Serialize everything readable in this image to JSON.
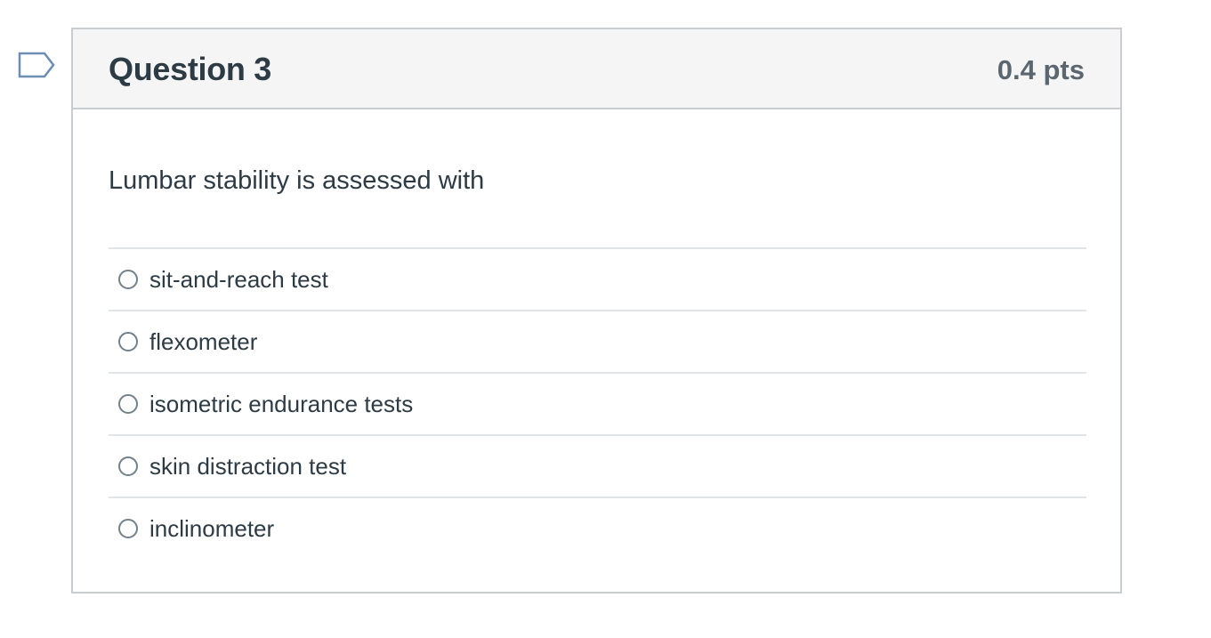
{
  "question": {
    "title": "Question 3",
    "points": "0.4 pts",
    "text": "Lumbar stability is assessed with",
    "answers": [
      {
        "label": "sit-and-reach test",
        "selected": false
      },
      {
        "label": "flexometer",
        "selected": false
      },
      {
        "label": "isometric endurance tests",
        "selected": false
      },
      {
        "label": "skin distraction test",
        "selected": false
      },
      {
        "label": "inclinometer",
        "selected": false
      }
    ]
  },
  "flag": {
    "icon": "flag-question-icon",
    "color": "#6d8db5"
  },
  "colors": {
    "header_bg": "#f5f5f5",
    "border": "#c7cdd1",
    "text": "#2d3b45",
    "points_text": "#5a6670",
    "radio_border": "#73818b"
  }
}
